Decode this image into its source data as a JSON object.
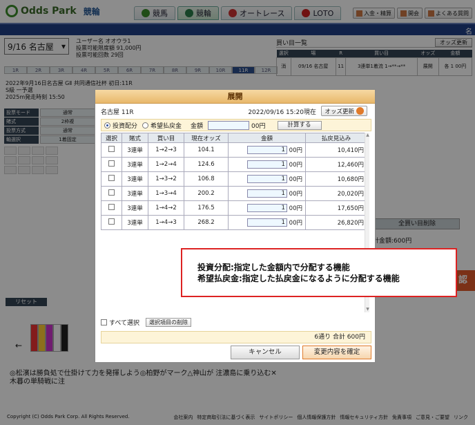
{
  "header": {
    "logo": "Odds Park",
    "logo_sub": "競輪",
    "nav": [
      {
        "label": "競馬",
        "icon": "horse-icon",
        "color": "#3b8c2a"
      },
      {
        "label": "競輪",
        "icon": "bicycle-icon",
        "color": "#2b7d4a"
      },
      {
        "label": "オートレース",
        "icon": "auto-race-icon",
        "color": "#c33"
      },
      {
        "label": "LOTO",
        "icon": "loto-icon",
        "color": "#c22"
      }
    ],
    "util": [
      {
        "label": "入金・精算",
        "icon": "wallet-icon"
      },
      {
        "label": "開会",
        "icon": "door-icon"
      },
      {
        "label": "よくある質問",
        "icon": "help-icon"
      }
    ],
    "bluebar_right": "名"
  },
  "bg": {
    "race_select": "9/16 名古屋",
    "user_lines": [
      "ユーザー名 オオウラ1",
      "投票可能限度額 91,000円",
      "投票可能回数 29回"
    ],
    "race_tabs": [
      "1R",
      "2R",
      "3R",
      "4R",
      "5R",
      "6R",
      "7R",
      "8R",
      "9R",
      "10R",
      "11R",
      "12R"
    ],
    "active_tab": "11R",
    "race_info": [
      "2022年9月16日名古屋  GⅡ 共同通信社杯 初日:11R",
      "S級  一予選",
      "2025m発走時刻 15:50"
    ],
    "left_rows": [
      {
        "label": "投票モード",
        "value": "通常"
      },
      {
        "label": "賭式",
        "value": "2枠複"
      },
      {
        "label": "投票方式",
        "value": "通常"
      },
      {
        "label": "軸選択",
        "value": "1着固定"
      }
    ],
    "reset_label": "リセット",
    "cart_title": "買い目一覧",
    "cart_odds_btn": "オッズ更新",
    "cart_headers": [
      "選択",
      "場",
      "R",
      "買い目",
      "オッズ",
      "金額"
    ],
    "cart_row": {
      "sel": "消",
      "venue": "09/16 名古屋",
      "race": "11",
      "bet": "3連単1着流 1→**→**",
      "odds": "展開",
      "amount": "各 1 00円"
    },
    "all_clear": "全買い目削除",
    "total_side": "計金額:600円",
    "auth_btn": "認",
    "marquee": "◎松濱は勝負処で仕掛けて力を発揮しよう◎柏野がマーク△神山が 注濃島に乗り込む✕木暮の単騎戦に注",
    "footer_copy": "Copyright (C) Odds Park Corp. All Rights Reserved.",
    "footer_links": [
      "会社案内",
      "特定商取引法に基づく表示",
      "サイトポリシー",
      "個人情報保護方針",
      "情報セキュリティ方針",
      "免責事項",
      "ご意見・ご要望",
      "リンク"
    ]
  },
  "modal": {
    "title": "展開",
    "venue_race": "名古屋 11R",
    "datetime": "2022/09/16 15:20現在",
    "odds_refresh": "オッズ更新",
    "mode_invest": "投資配分",
    "mode_payout": "希望払戻金",
    "amount_label": "金額",
    "amount_value": "",
    "amount_unit": "00円",
    "calc_btn": "計算する",
    "headers": [
      "選択",
      "賭式",
      "買い目",
      "現在オッズ",
      "金額",
      "払戻見込み"
    ],
    "rows": [
      {
        "type": "3連単",
        "combo": "1→2→3",
        "odds": "104.1",
        "amount": "1",
        "unit": "00円",
        "payout": "10,410円"
      },
      {
        "type": "3連単",
        "combo": "1→2→4",
        "odds": "124.6",
        "amount": "1",
        "unit": "00円",
        "payout": "12,460円"
      },
      {
        "type": "3連単",
        "combo": "1→3→2",
        "odds": "106.8",
        "amount": "1",
        "unit": "00円",
        "payout": "10,680円"
      },
      {
        "type": "3連単",
        "combo": "1→3→4",
        "odds": "200.2",
        "amount": "1",
        "unit": "00円",
        "payout": "20,020円"
      },
      {
        "type": "3連単",
        "combo": "1→4→2",
        "odds": "176.5",
        "amount": "1",
        "unit": "00円",
        "payout": "17,650円"
      },
      {
        "type": "3連単",
        "combo": "1→4→3",
        "odds": "268.2",
        "amount": "1",
        "unit": "00円",
        "payout": "26,820円"
      }
    ],
    "select_all": "すべて選択",
    "delete_selected": "選択項目の削除",
    "summary": "6通り  合計  600円",
    "cancel": "キャンセル",
    "confirm": "変更内容を確定"
  },
  "note": {
    "line1": "投資分配:指定した金額内で分配する機能",
    "line2": "希望払戻金:指定した払戻金になるように分配する機能"
  }
}
